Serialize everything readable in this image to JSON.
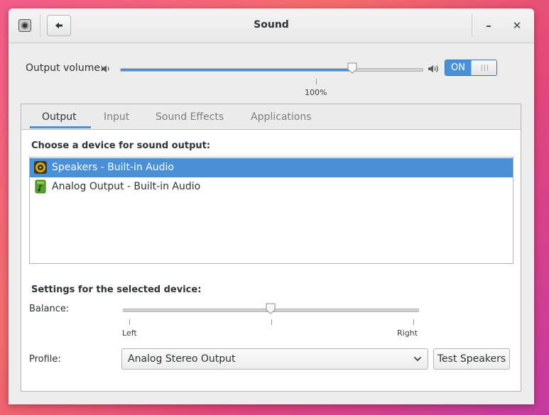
{
  "window": {
    "title": "Sound",
    "minimize_symbol": "–",
    "close_symbol": "✕"
  },
  "output_volume": {
    "label": "Output volume:",
    "level_percent": 77,
    "mark_label": "100%",
    "switch_label": "ON",
    "switch_state": true
  },
  "tabs": [
    {
      "label": "Output",
      "active": true
    },
    {
      "label": "Input",
      "active": false
    },
    {
      "label": "Sound Effects",
      "active": false
    },
    {
      "label": "Applications",
      "active": false
    }
  ],
  "output": {
    "choose_label": "Choose a device for sound output:",
    "devices": [
      {
        "name": "Speakers - Built-in Audio",
        "icon": "speaker-icon",
        "selected": true
      },
      {
        "name": "Analog Output - Built-in Audio",
        "icon": "audio-card-icon",
        "selected": false
      }
    ],
    "settings_label": "Settings for the selected device:",
    "balance": {
      "label": "Balance:",
      "left_label": "Left",
      "right_label": "Right",
      "value": 0.5
    },
    "profile": {
      "label": "Profile:",
      "value": "Analog Stereo Output"
    },
    "test_button": "Test Speakers"
  },
  "colors": {
    "accent": "#4a90d9",
    "window_bg": "#ededed"
  }
}
